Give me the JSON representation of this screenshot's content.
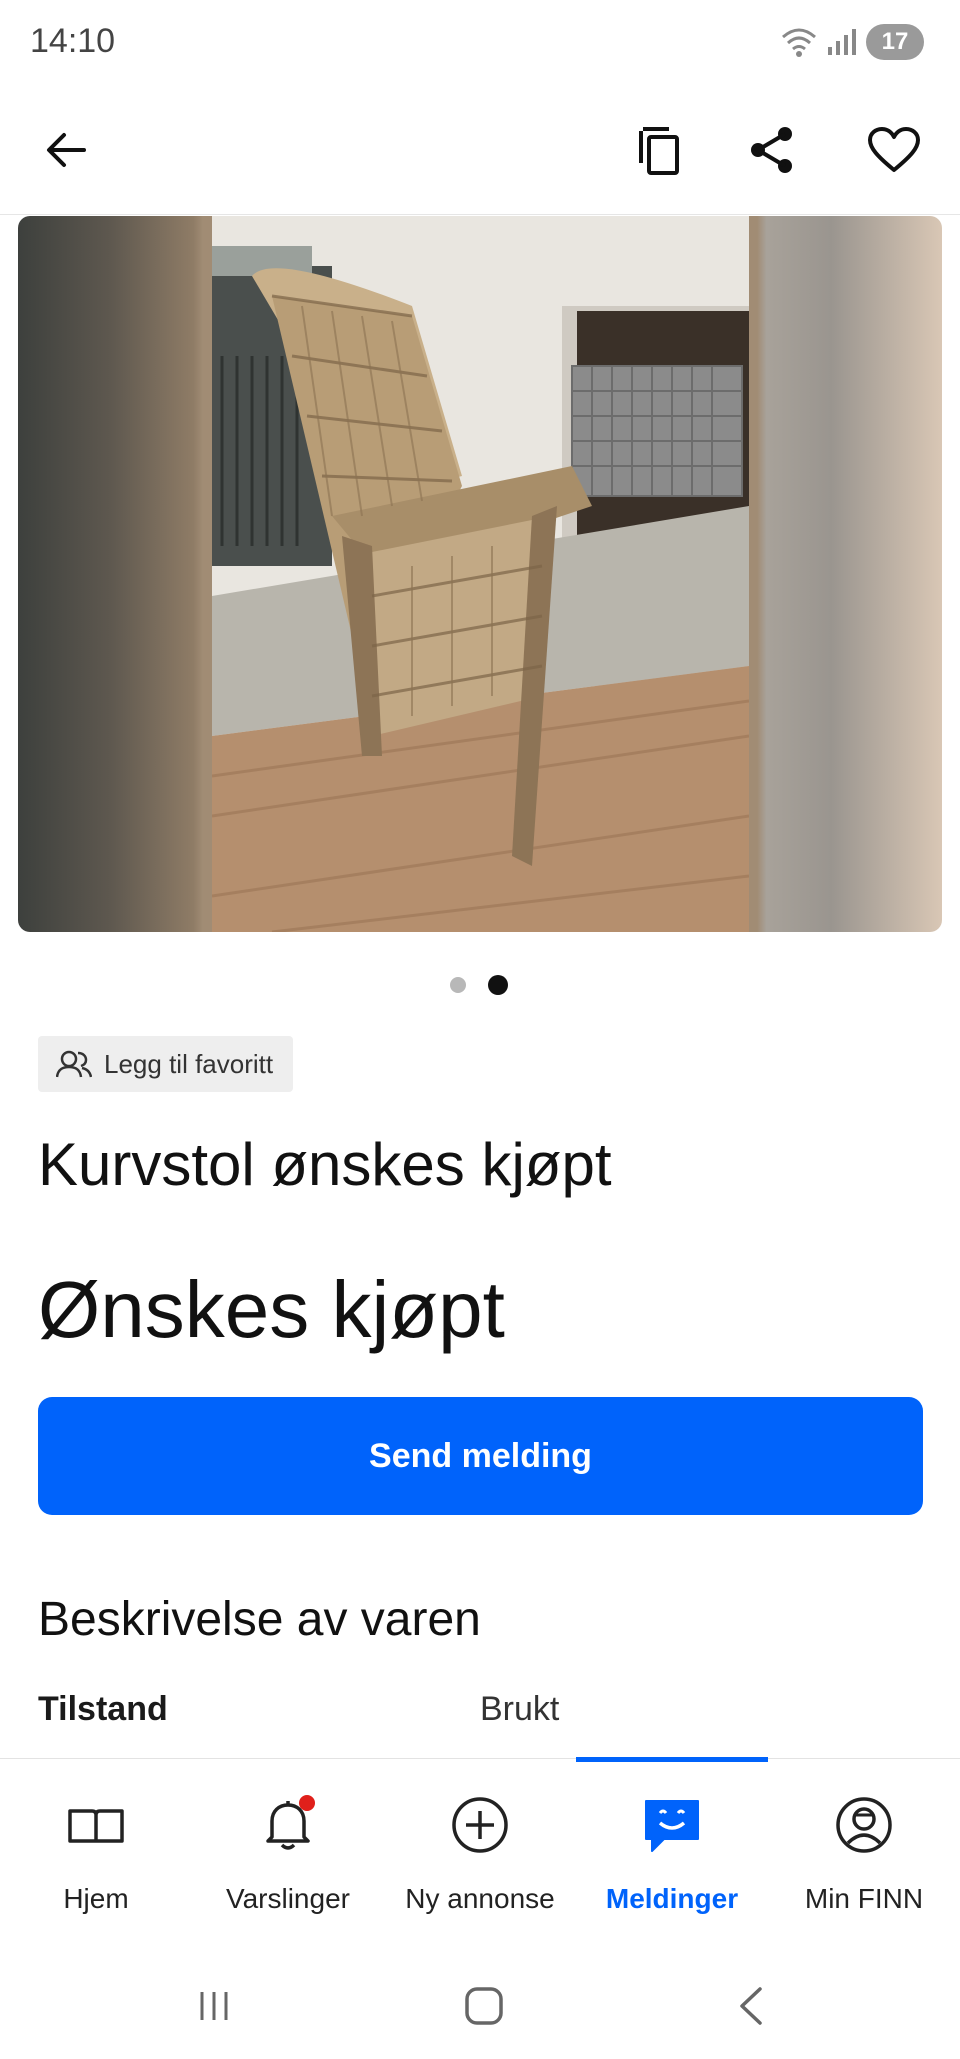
{
  "status_bar": {
    "time": "14:10",
    "battery": "17"
  },
  "header": {
    "icons": [
      "back-arrow-icon",
      "copy-icon",
      "share-icon",
      "heart-icon"
    ]
  },
  "gallery": {
    "photo_count": 2,
    "current_photo": 2
  },
  "favorite_chip": {
    "label": "Legg til favoritt"
  },
  "listing": {
    "title": "Kurvstol ønskes kjøpt",
    "price": "Ønskes kjøpt",
    "send_button": "Send melding"
  },
  "description": {
    "heading": "Beskrivelse av varen",
    "specs": [
      {
        "label": "Tilstand",
        "value": "Brukt"
      }
    ]
  },
  "bottom_nav": {
    "items": [
      {
        "label": "Hjem",
        "icon": "book-icon"
      },
      {
        "label": "Varslinger",
        "icon": "bell-icon"
      },
      {
        "label": "Ny annonse",
        "icon": "plus-circle-icon"
      },
      {
        "label": "Meldinger",
        "icon": "chat-icon"
      },
      {
        "label": "Min FINN",
        "icon": "profile-icon"
      }
    ],
    "active": "Meldinger"
  },
  "colors": {
    "accent": "#0063fb",
    "notification_dot": "#e0201b"
  }
}
